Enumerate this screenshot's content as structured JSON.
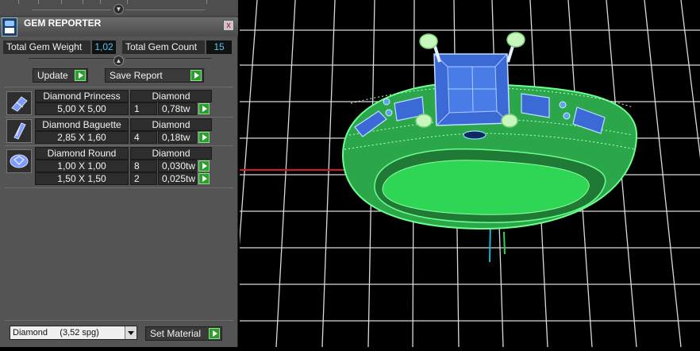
{
  "panel": {
    "title": "GEM REPORTER",
    "close_label": "x",
    "summary": {
      "weight_label": "Total Gem Weight",
      "weight_value": "1,02",
      "count_label": "Total Gem Count",
      "count_value": "15"
    },
    "buttons": {
      "update": "Update",
      "save_report": "Save Report",
      "set_material": "Set Material"
    },
    "gems": [
      {
        "name": "Diamond Princess",
        "material": "Diamond",
        "icon": "princess-cut-icon",
        "rows": [
          {
            "size": "5,00 X 5,00",
            "count": "1",
            "weight": "0,78tw"
          }
        ]
      },
      {
        "name": "Diamond Baguette",
        "material": "Diamond",
        "icon": "baguette-cut-icon",
        "rows": [
          {
            "size": "2,85 X 1,60",
            "count": "4",
            "weight": "0,18tw"
          }
        ]
      },
      {
        "name": "Diamond Round",
        "material": "Diamond",
        "icon": "round-cut-icon",
        "rows": [
          {
            "size": "1,00 X 1,00",
            "count": "8",
            "weight": "0,030tw"
          },
          {
            "size": "1,50 X 1,50",
            "count": "2",
            "weight": "0,025tw"
          }
        ]
      }
    ],
    "material_select": {
      "value": "Diamond     (3,52 spg)"
    }
  },
  "viewport": {
    "background": "#000000",
    "grid_color": "#ffffff",
    "ring_color": "#2fd655",
    "gem_color": "#3b6ad6",
    "x_axis_color": "#d91a1a",
    "y_axis_color": "#1ab4d6"
  }
}
